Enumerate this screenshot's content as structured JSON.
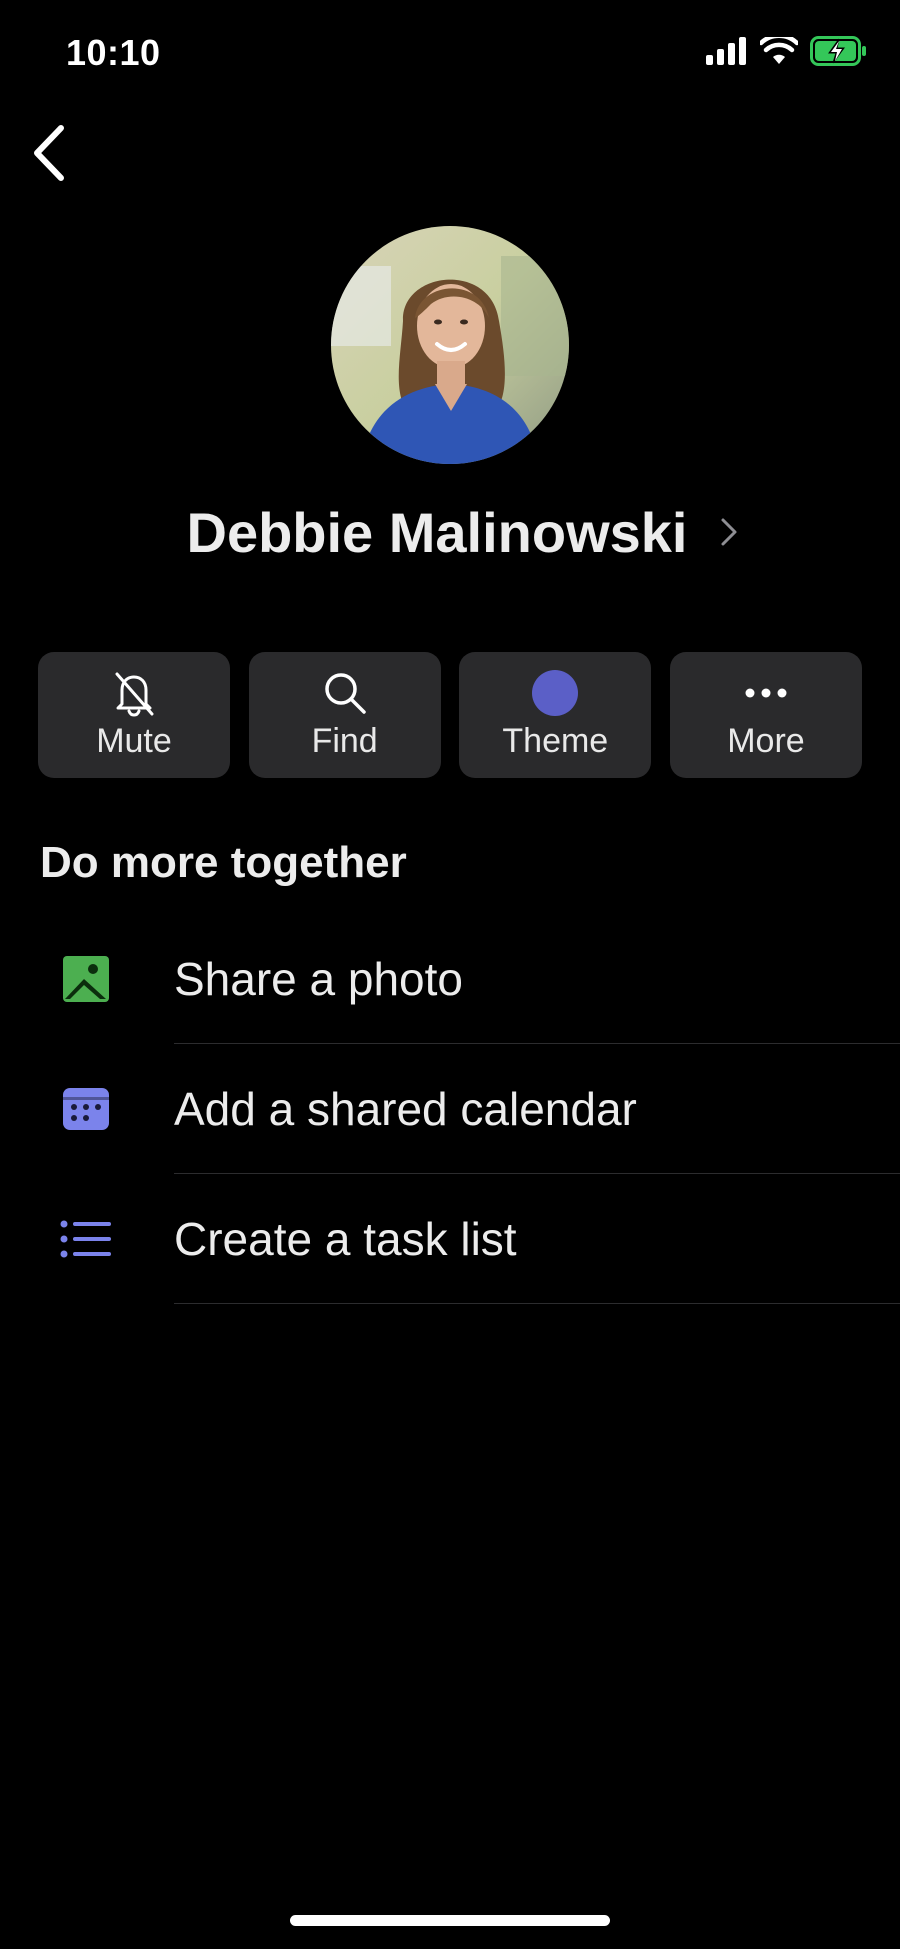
{
  "status_bar": {
    "time": "10:10"
  },
  "profile": {
    "name": "Debbie Malinowski"
  },
  "actions": [
    {
      "label": "Mute",
      "icon": "bell-off-icon"
    },
    {
      "label": "Find",
      "icon": "search-icon"
    },
    {
      "label": "Theme",
      "icon": "theme-color-icon"
    },
    {
      "label": "More",
      "icon": "more-icon"
    }
  ],
  "section": {
    "title": "Do more together"
  },
  "list": [
    {
      "label": "Share a photo",
      "icon": "photo-icon"
    },
    {
      "label": "Add a shared calendar",
      "icon": "calendar-icon"
    },
    {
      "label": "Create a task list",
      "icon": "task-list-icon"
    }
  ],
  "colors": {
    "background": "#000000",
    "button_bg": "#2a2a2c",
    "theme_accent": "#5b5fc7",
    "photo_icon_green": "#4caf50",
    "list_icon_purple": "#7b83eb",
    "battery_green": "#34c759"
  }
}
